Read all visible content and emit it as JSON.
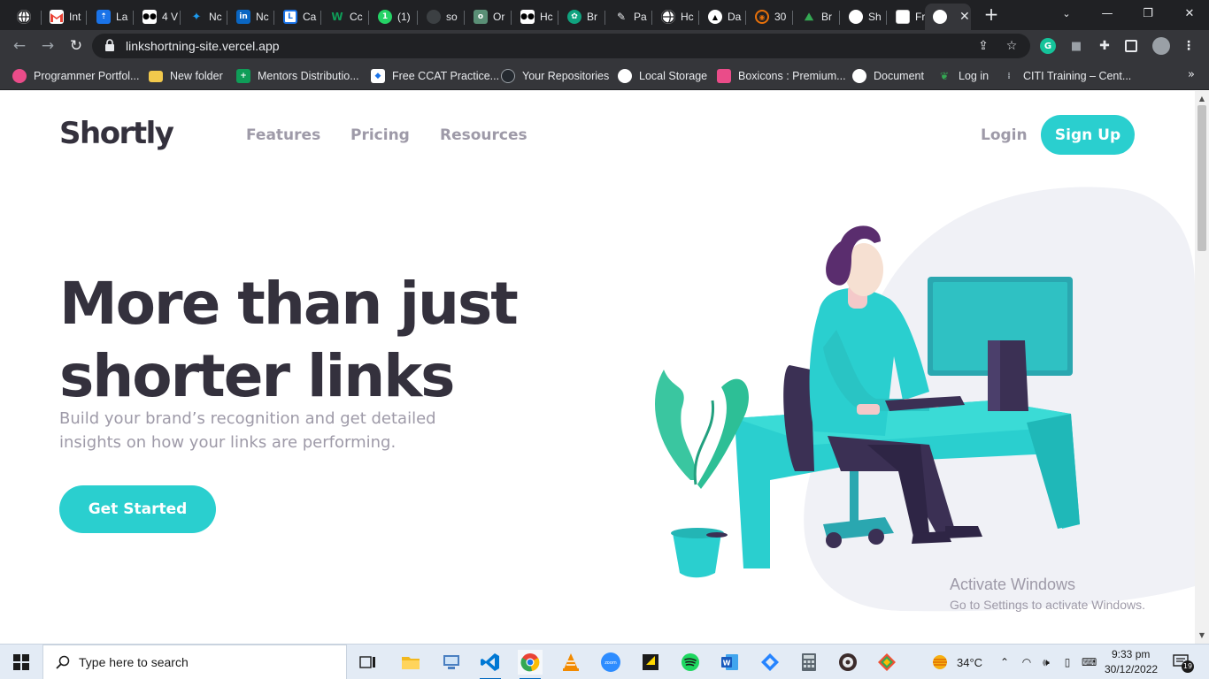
{
  "browser": {
    "tabs": [
      {
        "title": "",
        "icon": "globe-icon",
        "color": "#5f6368"
      },
      {
        "title": "Int",
        "icon": "gmail-icon",
        "color": "#ea4335"
      },
      {
        "title": "La",
        "icon": "runner-icon",
        "color": "#1a73e8"
      },
      {
        "title": "4 V",
        "icon": "medium-icon",
        "color": "#000000"
      },
      {
        "title": "Nc",
        "icon": "twitter-icon",
        "color": "#1d9bf0"
      },
      {
        "title": "Nc",
        "icon": "linkedin-icon",
        "color": "#0a66c2"
      },
      {
        "title": "Ca",
        "icon": "calendar-icon",
        "color": "#1a73e8"
      },
      {
        "title": "Cc",
        "icon": "w-icon",
        "color": "#0f9d58"
      },
      {
        "title": "(1)",
        "icon": "whatsapp-icon",
        "color": "#25d366"
      },
      {
        "title": "so",
        "icon": "github-icon",
        "color": "#24292f"
      },
      {
        "title": "Or",
        "icon": "o-icon",
        "color": "#5a8f76"
      },
      {
        "title": "Hc",
        "icon": "medium-icon",
        "color": "#000000"
      },
      {
        "title": "Br",
        "icon": "chatgpt-icon",
        "color": "#10a37f"
      },
      {
        "title": "Pa",
        "icon": "pen-icon",
        "color": "#3c4043"
      },
      {
        "title": "Hc",
        "icon": "globe-icon",
        "color": "#5f6368"
      },
      {
        "title": "Da",
        "icon": "triangle-icon",
        "color": "#000000"
      },
      {
        "title": "30",
        "icon": "fire-icon",
        "color": "#e8710a"
      },
      {
        "title": "Br",
        "icon": "mountain-icon",
        "color": "#34a853"
      },
      {
        "title": "Sh",
        "icon": "globe-icon",
        "color": "#5f6368"
      },
      {
        "title": "Fr",
        "icon": "page-icon",
        "color": "#dadce0"
      },
      {
        "title": "",
        "icon": "globe-icon",
        "color": "#5f6368",
        "active": true
      }
    ],
    "url": "linkshortning-site.vercel.app",
    "bookmarks": [
      {
        "label": "Programmer Portfol...",
        "icon": "dribbble-icon",
        "color": "#ea4c89"
      },
      {
        "label": "New folder",
        "icon": "folder-icon",
        "color": "#f2c94c"
      },
      {
        "label": "Mentors Distributio...",
        "icon": "sheets-icon",
        "color": "#0f9d58"
      },
      {
        "label": "Free CCAT Practice...",
        "icon": "cap-icon",
        "color": "#1a73e8"
      },
      {
        "label": "Your Repositories",
        "icon": "github-icon",
        "color": "#24292f"
      },
      {
        "label": "Local Storage",
        "icon": "globe-icon",
        "color": "#5f6368"
      },
      {
        "label": "Boxicons : Premium...",
        "icon": "box-icon",
        "color": "#ea4c89"
      },
      {
        "label": "Document",
        "icon": "globe-icon",
        "color": "#5f6368"
      },
      {
        "label": "Log in",
        "icon": "leaf-icon",
        "color": "#34a853"
      },
      {
        "label": "CITI Training – Cent...",
        "icon": "citi-icon",
        "color": "#5f6368"
      }
    ],
    "more_label": "»"
  },
  "site": {
    "logo": "Shortly",
    "nav": [
      "Features",
      "Pricing",
      "Resources"
    ],
    "login": "Login",
    "signup": "Sign Up",
    "hero_title": "More than just shorter links",
    "hero_subtitle": "Build your brand’s recognition and get detailed insights on how your links are performing.",
    "cta": "Get Started",
    "colors": {
      "cyan": "#2acfcf",
      "dark_violet": "#3b3054",
      "text": "#34313d",
      "gray": "#9e9aa8",
      "bg_gray": "#f0f1f6"
    }
  },
  "watermark": {
    "line1": "Activate Windows",
    "line2": "Go to Settings to activate Windows."
  },
  "taskbar": {
    "search_placeholder": "Type here to search",
    "apps": [
      "task-view",
      "file-explorer",
      "remote-desktop",
      "vscode",
      "chrome",
      "vlc",
      "zoom",
      "sticky-notes",
      "spotify",
      "word",
      "jira",
      "calculator",
      "media-player",
      "git"
    ],
    "weather": "34°C",
    "time": "9:33 pm",
    "date": "30/12/2022",
    "notifications": "19"
  }
}
